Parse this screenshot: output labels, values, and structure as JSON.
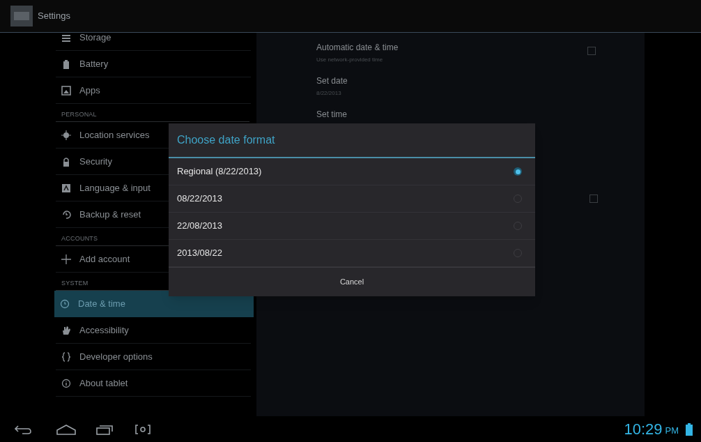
{
  "action_bar": {
    "title": "Settings"
  },
  "sidebar": [
    {
      "kind": "item",
      "label": "Storage",
      "selected": false
    },
    {
      "kind": "item",
      "label": "Battery",
      "selected": false
    },
    {
      "kind": "item",
      "label": "Apps",
      "selected": false
    },
    {
      "kind": "header",
      "label": "PERSONAL"
    },
    {
      "kind": "item",
      "label": "Location services",
      "selected": false
    },
    {
      "kind": "item",
      "label": "Security",
      "selected": false
    },
    {
      "kind": "item",
      "label": "Language & input",
      "selected": false
    },
    {
      "kind": "item",
      "label": "Backup & reset",
      "selected": false
    },
    {
      "kind": "header",
      "label": "ACCOUNTS"
    },
    {
      "kind": "item",
      "label": "Add account",
      "selected": false
    },
    {
      "kind": "header",
      "label": "SYSTEM"
    },
    {
      "kind": "item",
      "label": "Date & time",
      "selected": true
    },
    {
      "kind": "item",
      "label": "Accessibility",
      "selected": false
    },
    {
      "kind": "item",
      "label": "Developer options",
      "selected": false
    },
    {
      "kind": "item",
      "label": "About tablet",
      "selected": false
    }
  ],
  "settings": [
    {
      "kind": "checkbox",
      "title": "Automatic date & time",
      "summary": "Use network-provided time",
      "checked": false
    },
    {
      "kind": "plain",
      "title": "Set date",
      "summary": "8/22/2013"
    },
    {
      "kind": "plain",
      "title": "Set time"
    }
  ],
  "hidden_row_checkbox": {
    "checked": false
  },
  "dialog": {
    "title": "Choose date format",
    "options": [
      {
        "label": "Regional (8/22/2013)",
        "selected": true
      },
      {
        "label": "08/22/2013",
        "selected": false
      },
      {
        "label": "22/08/2013",
        "selected": false
      },
      {
        "label": "2013/08/22",
        "selected": false
      }
    ],
    "cancel": "Cancel"
  },
  "nav_bar": {
    "time": "10:29",
    "ampm": "PM"
  }
}
